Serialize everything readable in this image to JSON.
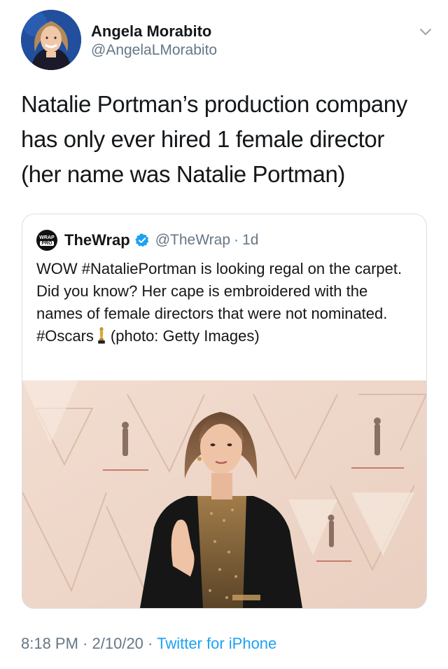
{
  "author": {
    "name": "Angela Morabito",
    "handle": "@AngelaLMorabito"
  },
  "tweet": {
    "text_lines": [
      "Natalie Portman’s production company",
      "has only ever hired 1 female director",
      "(her name was Natalie Portman)"
    ]
  },
  "quoted": {
    "logo_top": "WRAP",
    "logo_bottom": "PRO",
    "name": "TheWrap",
    "handle": "@TheWrap",
    "separator": "·",
    "time": "1d",
    "text_before_emoji": "WOW #NataliePortman is looking regal on the carpet. Did you know? Her cape is embroidered with the names of female directors that were not nominated. #Oscars",
    "text_after_emoji": "(photo: Getty Images)",
    "photo_icon": "oscars-red-carpet-photo"
  },
  "meta": {
    "time": "8:18 PM",
    "sep1": "·",
    "date": "2/10/20",
    "sep2": "·",
    "source": "Twitter for iPhone"
  },
  "colors": {
    "link": "#1da1f2",
    "secondary_text": "#657786",
    "primary_text": "#14171a",
    "verified": "#1da1f2"
  }
}
